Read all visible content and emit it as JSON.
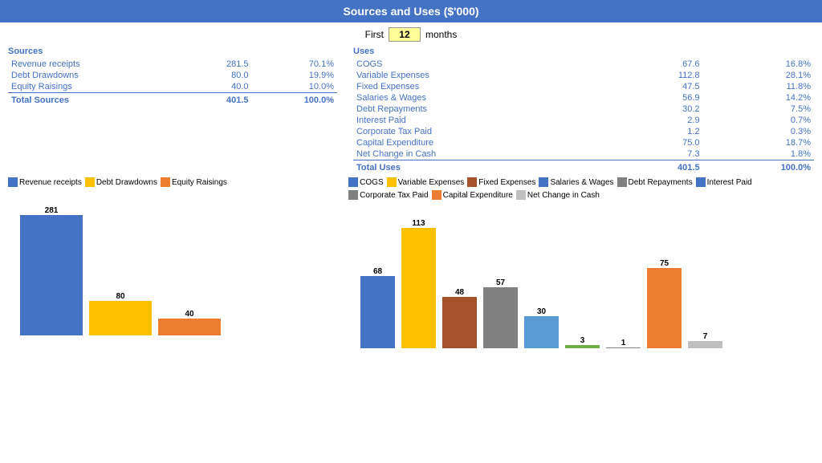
{
  "header": {
    "title": "Sources and Uses ($'000)"
  },
  "months_row": {
    "first_label": "First",
    "months_value": "12",
    "months_label": "months"
  },
  "sources": {
    "section_title": "Sources",
    "rows": [
      {
        "label": "Revenue receipts",
        "value": "281.5",
        "pct": "70.1%"
      },
      {
        "label": "Debt Drawdowns",
        "value": "80.0",
        "pct": "19.9%"
      },
      {
        "label": "Equity Raisings",
        "value": "40.0",
        "pct": "10.0%"
      }
    ],
    "total_label": "Total Sources",
    "total_value": "401.5",
    "total_pct": "100.0%"
  },
  "uses": {
    "section_title": "Uses",
    "rows": [
      {
        "label": "COGS",
        "value": "67.6",
        "pct": "16.8%"
      },
      {
        "label": "Variable Expenses",
        "value": "112.8",
        "pct": "28.1%"
      },
      {
        "label": "Fixed Expenses",
        "value": "47.5",
        "pct": "11.8%"
      },
      {
        "label": "Salaries & Wages",
        "value": "56.9",
        "pct": "14.2%"
      },
      {
        "label": "Debt Repayments",
        "value": "30.2",
        "pct": "7.5%"
      },
      {
        "label": "Interest Paid",
        "value": "2.9",
        "pct": "0.7%"
      },
      {
        "label": "Corporate Tax Paid",
        "value": "1.2",
        "pct": "0.3%"
      },
      {
        "label": "Capital Expenditure",
        "value": "75.0",
        "pct": "18.7%"
      },
      {
        "label": "Net Change in Cash",
        "value": "7.3",
        "pct": "1.8%"
      }
    ],
    "total_label": "Total Uses",
    "total_value": "401.5",
    "total_pct": "100.0%"
  },
  "left_legend": [
    {
      "label": "Revenue receipts",
      "color": "#4472C4"
    },
    {
      "label": "Debt Drawdowns",
      "color": "#FFC000"
    },
    {
      "label": "Equity Raisings",
      "color": "#ED7D31"
    }
  ],
  "right_legend": [
    {
      "label": "COGS",
      "color": "#4472C4"
    },
    {
      "label": "Variable Expenses",
      "color": "#FFC000"
    },
    {
      "label": "Fixed Expenses",
      "color": "#A5522A"
    },
    {
      "label": "Salaries & Wages",
      "color": "#4472C4"
    },
    {
      "label": "Debt Repayments",
      "color": "#808080"
    },
    {
      "label": "Interest Paid",
      "color": "#4472C4"
    },
    {
      "label": "Corporate Tax Paid",
      "color": "#808080"
    },
    {
      "label": "Capital Expenditure",
      "color": "#ED7D31"
    },
    {
      "label": "Net Change in Cash",
      "color": "#C0C0C0"
    }
  ],
  "left_bars": [
    {
      "label": "281",
      "value": 281,
      "color": "#4472C4"
    },
    {
      "label": "80",
      "value": 80,
      "color": "#FFC000"
    },
    {
      "label": "40",
      "value": 40,
      "color": "#ED7D31"
    }
  ],
  "right_bars": [
    {
      "label": "68",
      "value": 68,
      "color": "#4472C4"
    },
    {
      "label": "113",
      "value": 113,
      "color": "#FFC000"
    },
    {
      "label": "48",
      "value": 48,
      "color": "#A5522A"
    },
    {
      "label": "57",
      "value": 57,
      "color": "#808080"
    },
    {
      "label": "30",
      "value": 30,
      "color": "#5B9BD5"
    },
    {
      "label": "3",
      "value": 3,
      "color": "#70AD47"
    },
    {
      "label": "1",
      "value": 1,
      "color": "#808080"
    },
    {
      "label": "75",
      "value": 75,
      "color": "#ED7D31"
    },
    {
      "label": "7",
      "value": 7,
      "color": "#C0C0C0"
    }
  ]
}
